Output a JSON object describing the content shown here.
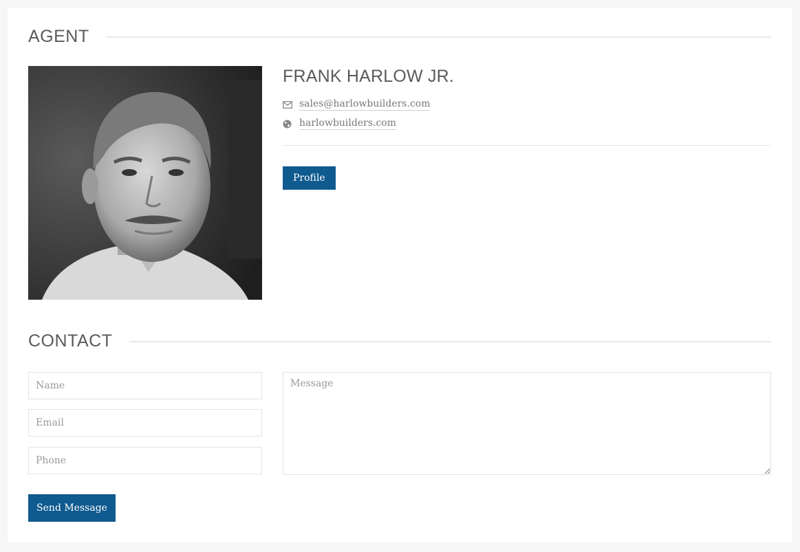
{
  "agent_section": {
    "title": "AGENT"
  },
  "agent": {
    "name": "FRANK HARLOW JR.",
    "email": "sales@harlowbuilders.com",
    "website": "harlowbuilders.com",
    "profile_button": "Profile",
    "email_icon": "envelope-icon",
    "website_icon": "globe-icon"
  },
  "contact_section": {
    "title": "CONTACT"
  },
  "contact_form": {
    "name_placeholder": "Name",
    "email_placeholder": "Email",
    "phone_placeholder": "Phone",
    "message_placeholder": "Message",
    "send_button": "Send Message"
  },
  "colors": {
    "accent": "#0f5a8f",
    "background": "#f7f7f7",
    "card": "#ffffff"
  }
}
